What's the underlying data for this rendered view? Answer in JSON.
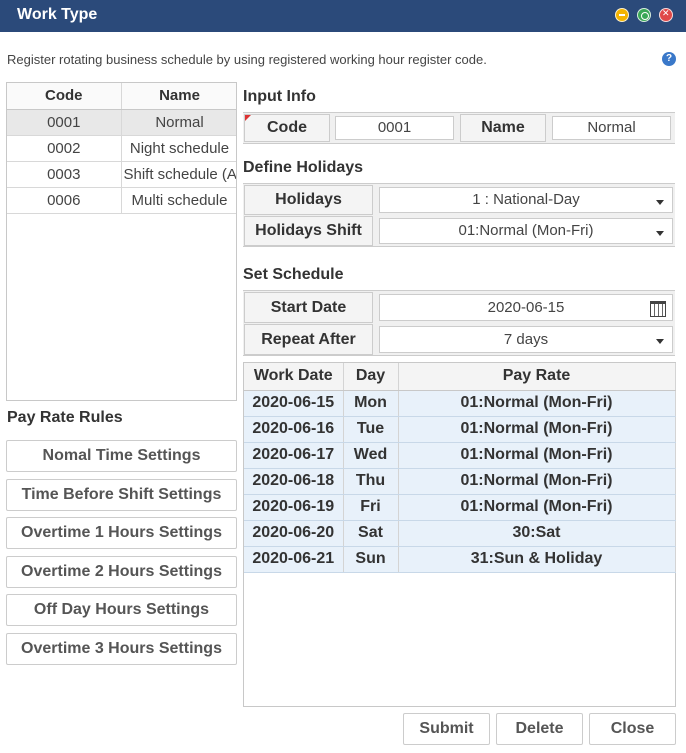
{
  "window": {
    "title": "Work Type"
  },
  "description": "Register rotating business schedule by using registered working hour register code.",
  "code_list": {
    "headers": [
      "Code",
      "Name"
    ],
    "rows": [
      {
        "code": "0001",
        "name": "Normal"
      },
      {
        "code": "0002",
        "name": "Night schedule"
      },
      {
        "code": "0003",
        "name": "Shift schedule (A"
      },
      {
        "code": "0006",
        "name": "Multi schedule"
      }
    ]
  },
  "pay_rate_rules": {
    "title": "Pay Rate Rules",
    "buttons": [
      "Nomal Time Settings",
      "Time Before Shift Settings",
      "Overtime 1 Hours Settings",
      "Overtime 2 Hours Settings",
      "Off Day Hours Settings",
      "Overtime 3 Hours Settings"
    ]
  },
  "input_info": {
    "title": "Input Info",
    "code_label": "Code",
    "code_value": "0001",
    "name_label": "Name",
    "name_value": "Normal"
  },
  "define_holidays": {
    "title": "Define Holidays",
    "holidays_label": "Holidays",
    "holidays_value": "1 : National-Day",
    "shift_label": "Holidays Shift",
    "shift_value": "01:Normal (Mon-Fri)"
  },
  "set_schedule": {
    "title": "Set Schedule",
    "start_label": "Start Date",
    "start_value": "2020-06-15",
    "repeat_label": "Repeat After",
    "repeat_value": "7 days"
  },
  "schedule_grid": {
    "headers": [
      "Work Date",
      "Day",
      "Pay Rate"
    ],
    "rows": [
      {
        "date": "2020-06-15",
        "day": "Mon",
        "rate": "01:Normal (Mon-Fri)"
      },
      {
        "date": "2020-06-16",
        "day": "Tue",
        "rate": "01:Normal (Mon-Fri)"
      },
      {
        "date": "2020-06-17",
        "day": "Wed",
        "rate": "01:Normal (Mon-Fri)"
      },
      {
        "date": "2020-06-18",
        "day": "Thu",
        "rate": "01:Normal (Mon-Fri)"
      },
      {
        "date": "2020-06-19",
        "day": "Fri",
        "rate": "01:Normal (Mon-Fri)"
      },
      {
        "date": "2020-06-20",
        "day": "Sat",
        "rate": "30:Sat"
      },
      {
        "date": "2020-06-21",
        "day": "Sun",
        "rate": "31:Sun & Holiday"
      }
    ]
  },
  "actions": {
    "submit": "Submit",
    "delete": "Delete",
    "close": "Close"
  },
  "colors": {
    "titlebar": "#2b4a7a",
    "grid_row": "#e8f1fa",
    "selected_row": "#e8e8e8"
  }
}
